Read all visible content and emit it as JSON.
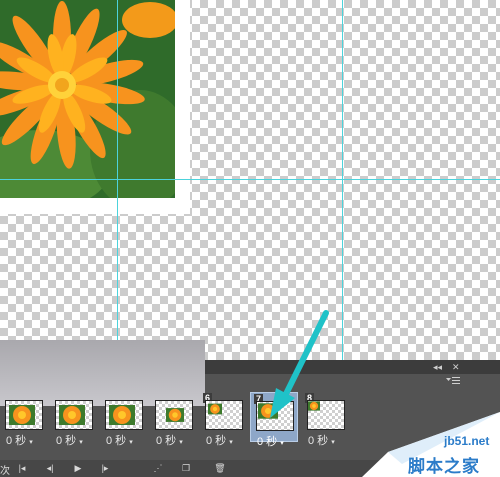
{
  "canvas": {
    "guide_color": "#4cd3dc"
  },
  "panel": {
    "controls": [
      "◂◂",
      "✕"
    ],
    "menu_icon": "panel-menu-icon"
  },
  "frames": [
    {
      "number": "",
      "delay": "0 秒",
      "selected": false
    },
    {
      "number": "",
      "delay": "0 秒",
      "selected": false
    },
    {
      "number": "",
      "delay": "0 秒",
      "selected": false
    },
    {
      "number": "",
      "delay": "0 秒",
      "selected": false
    },
    {
      "number": "6",
      "delay": "0 秒",
      "selected": false
    },
    {
      "number": "7",
      "delay": "0 秒",
      "selected": true
    },
    {
      "number": "8",
      "delay": "0 秒",
      "selected": false
    }
  ],
  "toolbar": {
    "loop_label": "次",
    "buttons": [
      "first-frame",
      "previous-frame",
      "play",
      "next-frame",
      "tween",
      "new-frame",
      "delete-frame"
    ]
  },
  "watermark": {
    "site": "jb51.net",
    "name": "脚本之家"
  },
  "colors": {
    "selected_frame": "#8ea7c8",
    "arrow": "#1fc2c8",
    "watermark": "#2b7cc9"
  }
}
